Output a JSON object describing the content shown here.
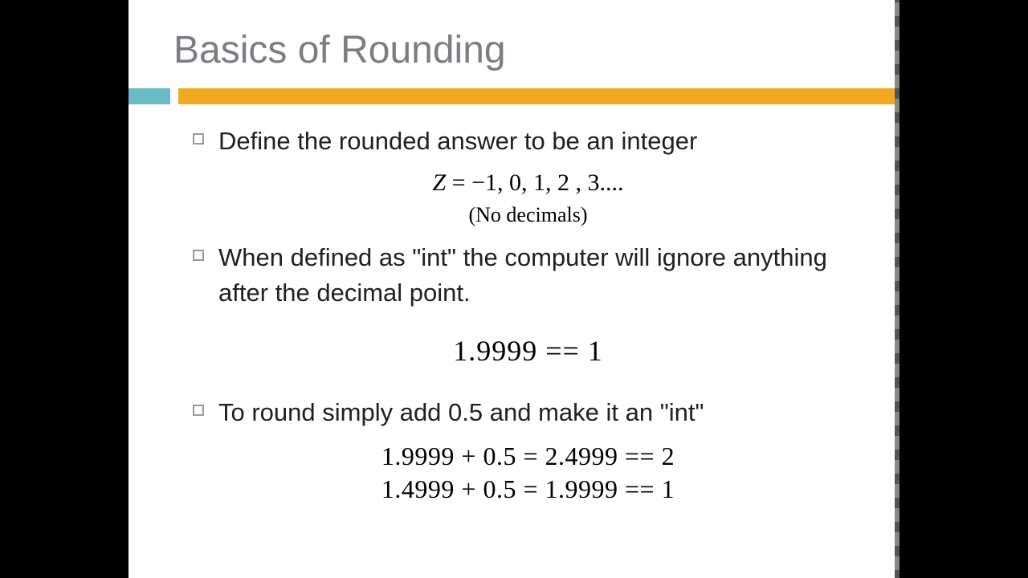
{
  "title": "Basics of Rounding",
  "bullets": {
    "b1": "Define the rounded answer to be an integer",
    "b2": "When defined as \"int\" the computer will ignore anything after the decimal point.",
    "b3": "To round simply add 0.5 and make it an \"int\""
  },
  "math": {
    "zline_prefix": "Z",
    "zline_rest": " = −1,  0,  1,  2 ,  3....",
    "no_decimals": "(No decimals)",
    "eq1": "1.9999  ==  1",
    "calc1": "1.9999  +  0.5  =  2.4999   ==   2",
    "calc2": "1.4999  +  0.5  =  1.9999   ==   1"
  }
}
